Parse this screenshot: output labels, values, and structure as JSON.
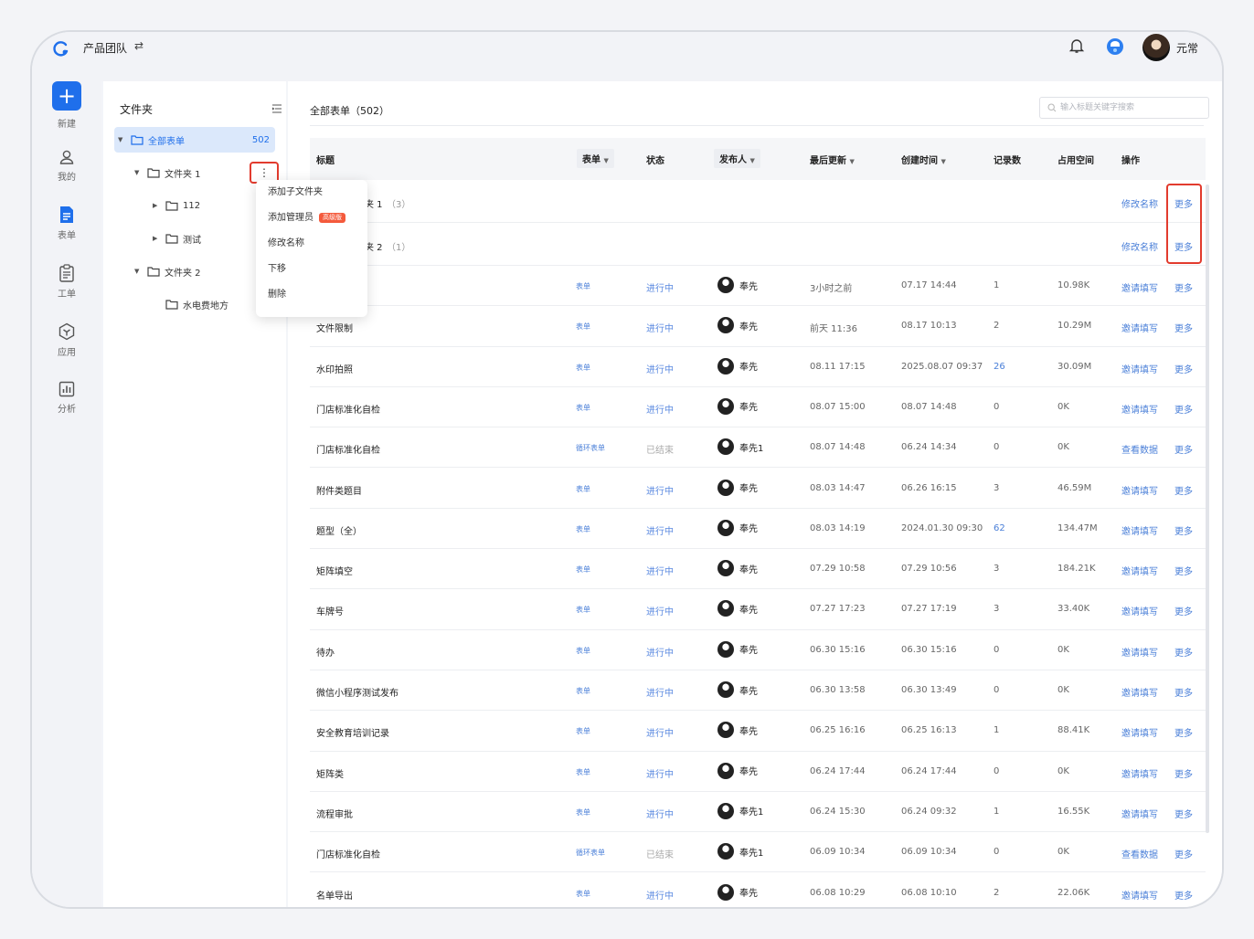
{
  "header": {
    "team_name": "产品团队",
    "switch_icon": "⇄",
    "user_name": "元常"
  },
  "nav": [
    {
      "label": "新建",
      "icon": "plus-icon"
    },
    {
      "label": "我的",
      "icon": "user-icon"
    },
    {
      "label": "表单",
      "icon": "form-icon"
    },
    {
      "label": "工单",
      "icon": "clipboard-icon"
    },
    {
      "label": "应用",
      "icon": "app-icon"
    },
    {
      "label": "分析",
      "icon": "chart-icon"
    }
  ],
  "folders": {
    "title": "文件夹",
    "all_label": "全部表单",
    "all_count": "502",
    "items": [
      {
        "label": "文件夹 1"
      },
      {
        "label": "112"
      },
      {
        "label": "测试"
      },
      {
        "label": "文件夹 2"
      },
      {
        "label": "水电费地方"
      }
    ],
    "kebab": "⋮"
  },
  "context_menu": [
    {
      "label": "添加子文件夹"
    },
    {
      "label": "添加管理员",
      "badge": "高级版"
    },
    {
      "label": "修改名称"
    },
    {
      "label": "下移"
    },
    {
      "label": "删除"
    }
  ],
  "main": {
    "title": "全部表单（502）",
    "search_placeholder": "输入标题关键字搜索",
    "columns": {
      "title": "标题",
      "form": "表单",
      "status": "状态",
      "publisher": "发布人",
      "last_update": "最后更新",
      "created": "创建时间",
      "records": "记录数",
      "space": "占用空间",
      "ops": "操作"
    },
    "folder_rows": [
      {
        "name": "夹 1",
        "count": "（3）",
        "op1": "修改名称",
        "op2": "更多"
      },
      {
        "name": "夹 2",
        "count": "（1）",
        "op1": "修改名称",
        "op2": "更多"
      }
    ],
    "rows": [
      {
        "title": "",
        "type": "表单",
        "status": "进行中",
        "user": "奉先",
        "updated": "3小时之前",
        "created": "07.17 14:44",
        "records": "1",
        "space": "10.98K",
        "op1": "邀请填写",
        "op2": "更多"
      },
      {
        "title": "文件限制",
        "type": "表单",
        "status": "进行中",
        "user": "奉先",
        "updated": "前天 11:36",
        "created": "08.17 10:13",
        "records": "2",
        "space": "10.29M",
        "op1": "邀请填写",
        "op2": "更多"
      },
      {
        "title": "水印拍照",
        "type": "表单",
        "status": "进行中",
        "user": "奉先",
        "updated": "08.11 17:15",
        "created": "2025.08.07 09:37",
        "records": "26",
        "space": "30.09M",
        "op1": "邀请填写",
        "op2": "更多"
      },
      {
        "title": "门店标准化自检",
        "type": "表单",
        "status": "进行中",
        "user": "奉先",
        "updated": "08.07 15:00",
        "created": "08.07 14:48",
        "records": "0",
        "space": "0K",
        "op1": "邀请填写",
        "op2": "更多"
      },
      {
        "title": "门店标准化自检",
        "type": "循环表单",
        "status": "已结束",
        "user": "奉先1",
        "updated": "08.07 14:48",
        "created": "06.24 14:34",
        "records": "0",
        "space": "0K",
        "op1": "查看数据",
        "op2": "更多"
      },
      {
        "title": "附件类题目",
        "type": "表单",
        "status": "进行中",
        "user": "奉先",
        "updated": "08.03 14:47",
        "created": "06.26 16:15",
        "records": "3",
        "space": "46.59M",
        "op1": "邀请填写",
        "op2": "更多"
      },
      {
        "title": "题型（全）",
        "type": "表单",
        "status": "进行中",
        "user": "奉先",
        "updated": "08.03 14:19",
        "created": "2024.01.30 09:30",
        "records": "62",
        "space": "134.47M",
        "op1": "邀请填写",
        "op2": "更多"
      },
      {
        "title": "矩阵填空",
        "type": "表单",
        "status": "进行中",
        "user": "奉先",
        "updated": "07.29 10:58",
        "created": "07.29 10:56",
        "records": "3",
        "space": "184.21K",
        "op1": "邀请填写",
        "op2": "更多"
      },
      {
        "title": "车牌号",
        "type": "表单",
        "status": "进行中",
        "user": "奉先",
        "updated": "07.27 17:23",
        "created": "07.27 17:19",
        "records": "3",
        "space": "33.40K",
        "op1": "邀请填写",
        "op2": "更多"
      },
      {
        "title": "待办",
        "type": "表单",
        "status": "进行中",
        "user": "奉先",
        "updated": "06.30 15:16",
        "created": "06.30 15:16",
        "records": "0",
        "space": "0K",
        "op1": "邀请填写",
        "op2": "更多"
      },
      {
        "title": "微信小程序测试发布",
        "type": "表单",
        "status": "进行中",
        "user": "奉先",
        "updated": "06.30 13:58",
        "created": "06.30 13:49",
        "records": "0",
        "space": "0K",
        "op1": "邀请填写",
        "op2": "更多"
      },
      {
        "title": "安全教育培训记录",
        "type": "表单",
        "status": "进行中",
        "user": "奉先",
        "updated": "06.25 16:16",
        "created": "06.25 16:13",
        "records": "1",
        "space": "88.41K",
        "op1": "邀请填写",
        "op2": "更多"
      },
      {
        "title": "矩阵类",
        "type": "表单",
        "status": "进行中",
        "user": "奉先",
        "updated": "06.24 17:44",
        "created": "06.24 17:44",
        "records": "0",
        "space": "0K",
        "op1": "邀请填写",
        "op2": "更多"
      },
      {
        "title": "流程审批",
        "type": "表单",
        "status": "进行中",
        "user": "奉先1",
        "updated": "06.24 15:30",
        "created": "06.24 09:32",
        "records": "1",
        "space": "16.55K",
        "op1": "邀请填写",
        "op2": "更多"
      },
      {
        "title": "门店标准化自检",
        "type": "循环表单",
        "status": "已结束",
        "user": "奉先1",
        "updated": "06.09 10:34",
        "created": "06.09 10:34",
        "records": "0",
        "space": "0K",
        "op1": "查看数据",
        "op2": "更多"
      },
      {
        "title": "名单导出",
        "type": "表单",
        "status": "进行中",
        "user": "奉先",
        "updated": "06.08 10:29",
        "created": "06.08 10:10",
        "records": "2",
        "space": "22.06K",
        "op1": "邀请填写",
        "op2": "更多"
      }
    ]
  }
}
